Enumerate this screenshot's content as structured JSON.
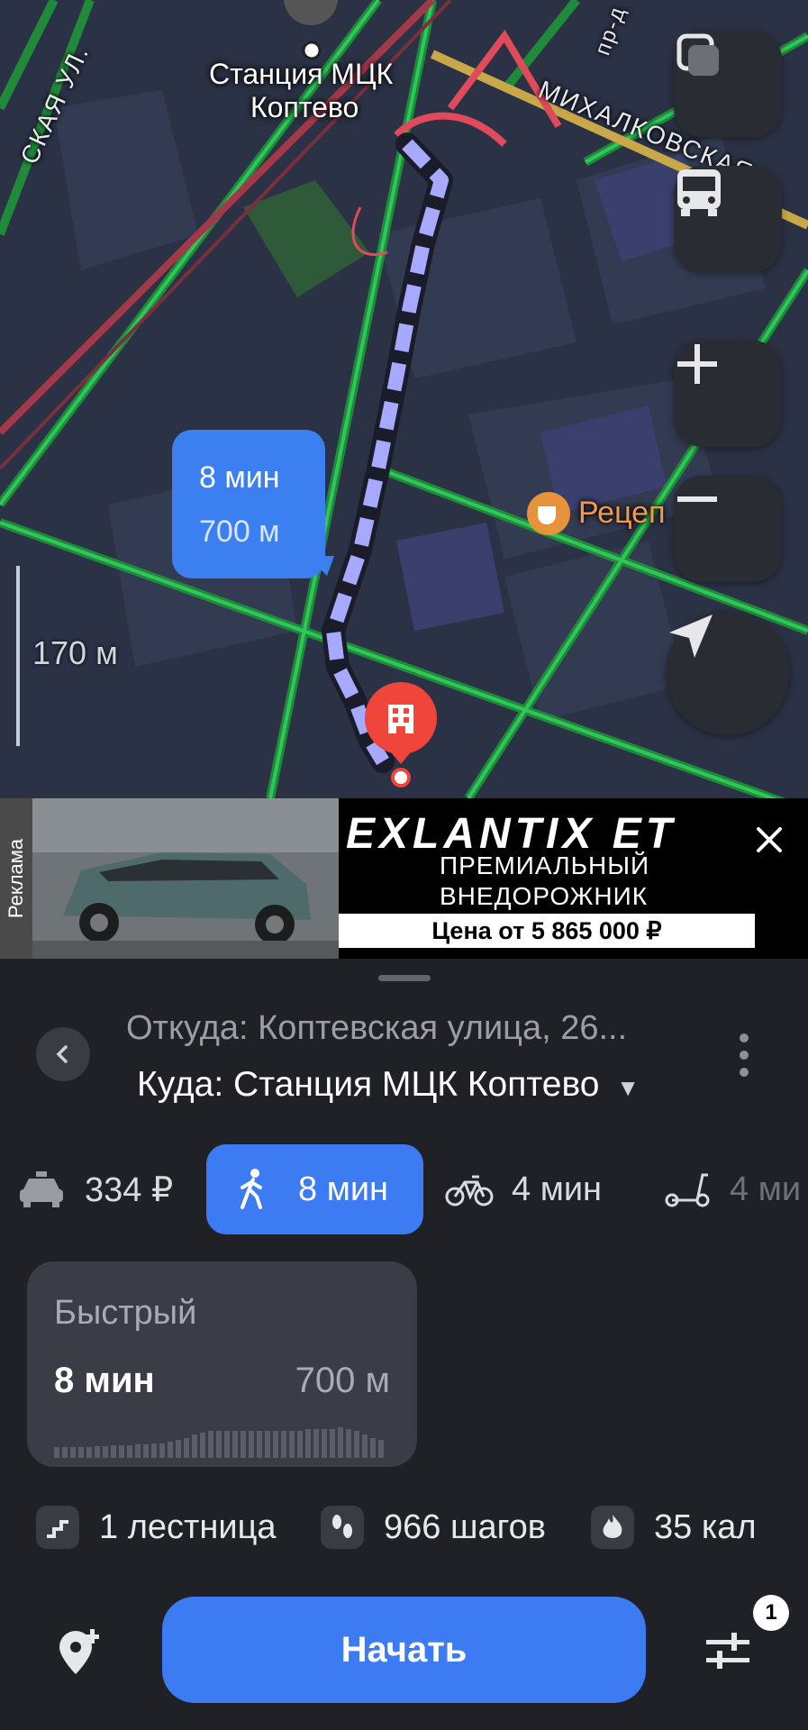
{
  "map": {
    "station_label_line1": "Станция МЦК",
    "station_label_line2": "Коптево",
    "street_mikhalkovskaya": "МИХАЛКОВСКАЯ",
    "street_ul": "СКАЯ УЛ.",
    "street_pr": "пр-д",
    "poi_recept": "Рецеп",
    "route_bubble_time": "8 мин",
    "route_bubble_distance": "700 м",
    "scale": "170 м",
    "route_color": "#a7a9ff",
    "destination_pin_color": "#f0453a"
  },
  "ad": {
    "badge": "Реклама",
    "brand": "EXLANTIX ET",
    "subtitle_line1": "ПРЕМИАЛЬНЫЙ",
    "subtitle_line2": "ВНЕДОРОЖНИК",
    "price": "Цена от 5 865 000 ₽"
  },
  "route": {
    "from": "Откуда: Коптевская улица, 26...",
    "to": "Куда: Станция МЦК Коптево",
    "to_arrow": "▼"
  },
  "modes": [
    {
      "icon": "taxi-icon",
      "label": "334 ₽"
    },
    {
      "icon": "walk-icon",
      "label": "8 мин",
      "active": true
    },
    {
      "icon": "bicycle-icon",
      "label": "4 мин"
    },
    {
      "icon": "scooter-icon",
      "label": "4 ми"
    }
  ],
  "route_card": {
    "title": "Быстрый",
    "time": "8 мин",
    "distance": "700 м"
  },
  "stats": {
    "stairs": "1 лестница",
    "steps": "966 шагов",
    "calories": "35 кал"
  },
  "footer": {
    "start_label": "Начать",
    "filters_badge": "1"
  },
  "colors": {
    "accent": "#3d7bf2",
    "background": "#1f2127"
  }
}
